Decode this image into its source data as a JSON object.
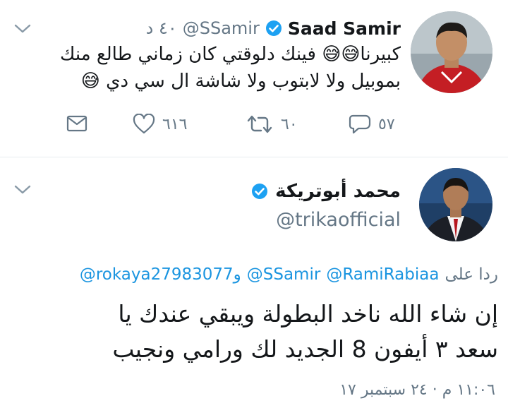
{
  "tweet1": {
    "author_name": "Saad Samir",
    "handle": "@SSamir",
    "time": "٤٠ د",
    "text_line1": "كبيرنا😅😅 فينك دلوقتي كان زماني طالع منك",
    "text_line2": "بموبيل ولا لابتوب ولا شاشة ال سي دي 😅",
    "reply_count": "٥٧",
    "retweet_count": "٦٠",
    "like_count": "٦١٦"
  },
  "tweet2": {
    "author_name": "محمد أبوتريكة",
    "handle": "@trikaofficial",
    "reply_prefix": "ردا على",
    "reply_to_1": "@RamiRabiaa",
    "reply_to_2": "@SSamir",
    "reply_and": "و",
    "reply_to_3": "@rokaya27983077",
    "text_line1": "إن شاء الله ناخد البطولة ويبقي عندك يا",
    "text_line2": "سعد ٣ أيفون 8 الجديد لك ورامي ونجيب",
    "timestamp": "١١:٠٦ م · ٢٤ سبتمبر ١٧"
  },
  "colors": {
    "verified": "#1da1f2",
    "link": "#1b95e0",
    "muted": "#657786"
  },
  "icons": [
    "chevron-down-icon",
    "verified-badge-icon",
    "reply-icon",
    "retweet-icon",
    "like-icon",
    "message-icon"
  ]
}
